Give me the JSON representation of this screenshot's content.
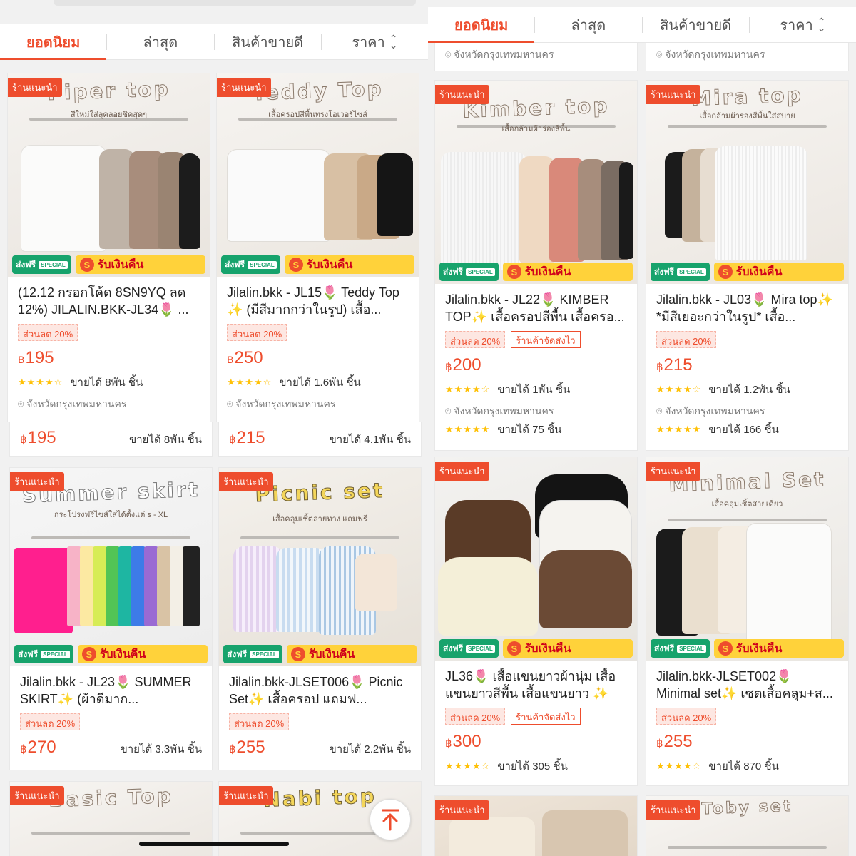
{
  "sort_tabs": [
    {
      "label": "ยอดนิยม"
    },
    {
      "label": "ล่าสุด"
    },
    {
      "label": "สินค้าขายดี"
    },
    {
      "label": "ราคา"
    }
  ],
  "badges": {
    "recommended": "ร้านแนะนำ",
    "free_ship": "ส่งฟรี",
    "special": "SPECIAL",
    "cashback": "รับเงินคืน",
    "coin": "S"
  },
  "left_products": [
    {
      "img_title": "Piper top",
      "img_sub": "สีใหม่ใส่ลุคลอยชิคสุดๆ",
      "title": "(12.12 กรอกโค้ด 8SN9YQ ลด 12%) JILALIN.BKK-JL34🌷 ...",
      "discount": "ส่วนลด 20%",
      "price": "195",
      "sold": "ขายได้ 8พัน ชิ้น",
      "location": "จังหวัดกรุงเทพมหานคร"
    },
    {
      "img_title": "Teddy Top",
      "img_sub": "เสื้อครอปสีพื้นทรงโอเวอร์ไซส์",
      "title": "Jilalin.bkk - JL15🌷 Teddy Top ✨ (มีสีมากกว่าในรูป) เสื้อ...",
      "discount": "ส่วนลด 20%",
      "price": "250",
      "sold": "ขายได้ 1.6พัน ชิ้น",
      "location": "จังหวัดกรุงเทพมหานคร"
    },
    {
      "img_title": "Summer skirt",
      "img_sub": "กระโปรงฟรีไซส์ใส่ได้ตั้งแต่ s - XL",
      "title": "Jilalin.bkk - JL23🌷 SUMMER SKIRT✨ (ผ้าดีมาก...",
      "discount": "ส่วนลด 20%",
      "price": "270",
      "sold": "ขายได้ 3.3พัน ชิ้น"
    },
    {
      "img_title": "Picnic set",
      "img_sub": "เสื้อคลุมเชิ้ตลายทาง แถมฟรี",
      "title": "Jilalin.bkk-JLSET006🌷 Picnic Set✨ เสื้อครอป แถมฟ...",
      "discount": "ส่วนลด 20%",
      "price": "255",
      "sold": "ขายได้ 2.2พัน ชิ้น"
    },
    {
      "img_title": "Basic Top"
    },
    {
      "img_title": "Nabi top"
    }
  ],
  "left_strips": [
    {
      "price": "195",
      "sold": "ขายได้ 8พัน ชิ้น"
    },
    {
      "price": "215",
      "sold": "ขายได้ 4.1พัน ชิ้น"
    }
  ],
  "right_top_locations": [
    "จังหวัดกรุงเทพมหานคร",
    "จังหวัดกรุงเทพมหานคร"
  ],
  "right_products": [
    {
      "img_title": "Kimber top",
      "img_sub": "เสื้อกล้ามผ้าร่องสีพื้น",
      "title": "Jilalin.bkk - JL22🌷 KIMBER TOP✨ เสื้อครอปสีพื้น เสื้อครอ...",
      "discount": "ส่วนลด 20%",
      "ship": "ร้านค้าจัดส่งไว",
      "price": "200",
      "sold": "ขายได้ 1พัน ชิ้น",
      "location": "จังหวัดกรุงเทพมหานคร",
      "sold2": "ขายได้ 75 ชิ้น"
    },
    {
      "img_title": "Mira top",
      "img_sub": "เสื้อกล้ามผ้าร่องสีพื้นใส่สบาย",
      "title": "Jilalin.bkk - JL03🌷 Mira top✨ *มีสีเยอะกว่าในรูป* เสื้อ...",
      "discount": "ส่วนลด 20%",
      "price": "215",
      "sold": "ขายได้ 1.2พัน ชิ้น",
      "location": "จังหวัดกรุงเทพมหานคร",
      "sold2": "ขายได้ 166 ชิ้น"
    },
    {
      "img_title": "",
      "img_sub": "",
      "title": "JL36🌷 เสื้อแขนยาวผ้านุ่ม เสื้อแขนยาวสีพื้น เสื้อแขนยาว ✨",
      "discount": "ส่วนลด 20%",
      "ship": "ร้านค้าจัดส่งไว",
      "price": "300",
      "sold": "ขายได้ 305 ชิ้น"
    },
    {
      "img_title": "Minimal Set",
      "img_sub": "เสื้อคลุมเชิ้ตสายเดี่ยว",
      "title": "Jilalin.bkk-JLSET002🌷 Minimal set✨ เซตเสื้อคลุม+ส...",
      "discount": "ส่วนลด 20%",
      "price": "255",
      "sold": "ขายได้ 870 ชิ้น"
    },
    {
      "img_title": ""
    },
    {
      "img_title": "Toby set"
    }
  ],
  "currency": "฿",
  "stars": "★★★★☆",
  "stars_full": "★★★★★",
  "icons": {
    "pin": "location-pin-icon",
    "sort": "sort-arrows-icon",
    "fab": "scroll-top-icon"
  }
}
